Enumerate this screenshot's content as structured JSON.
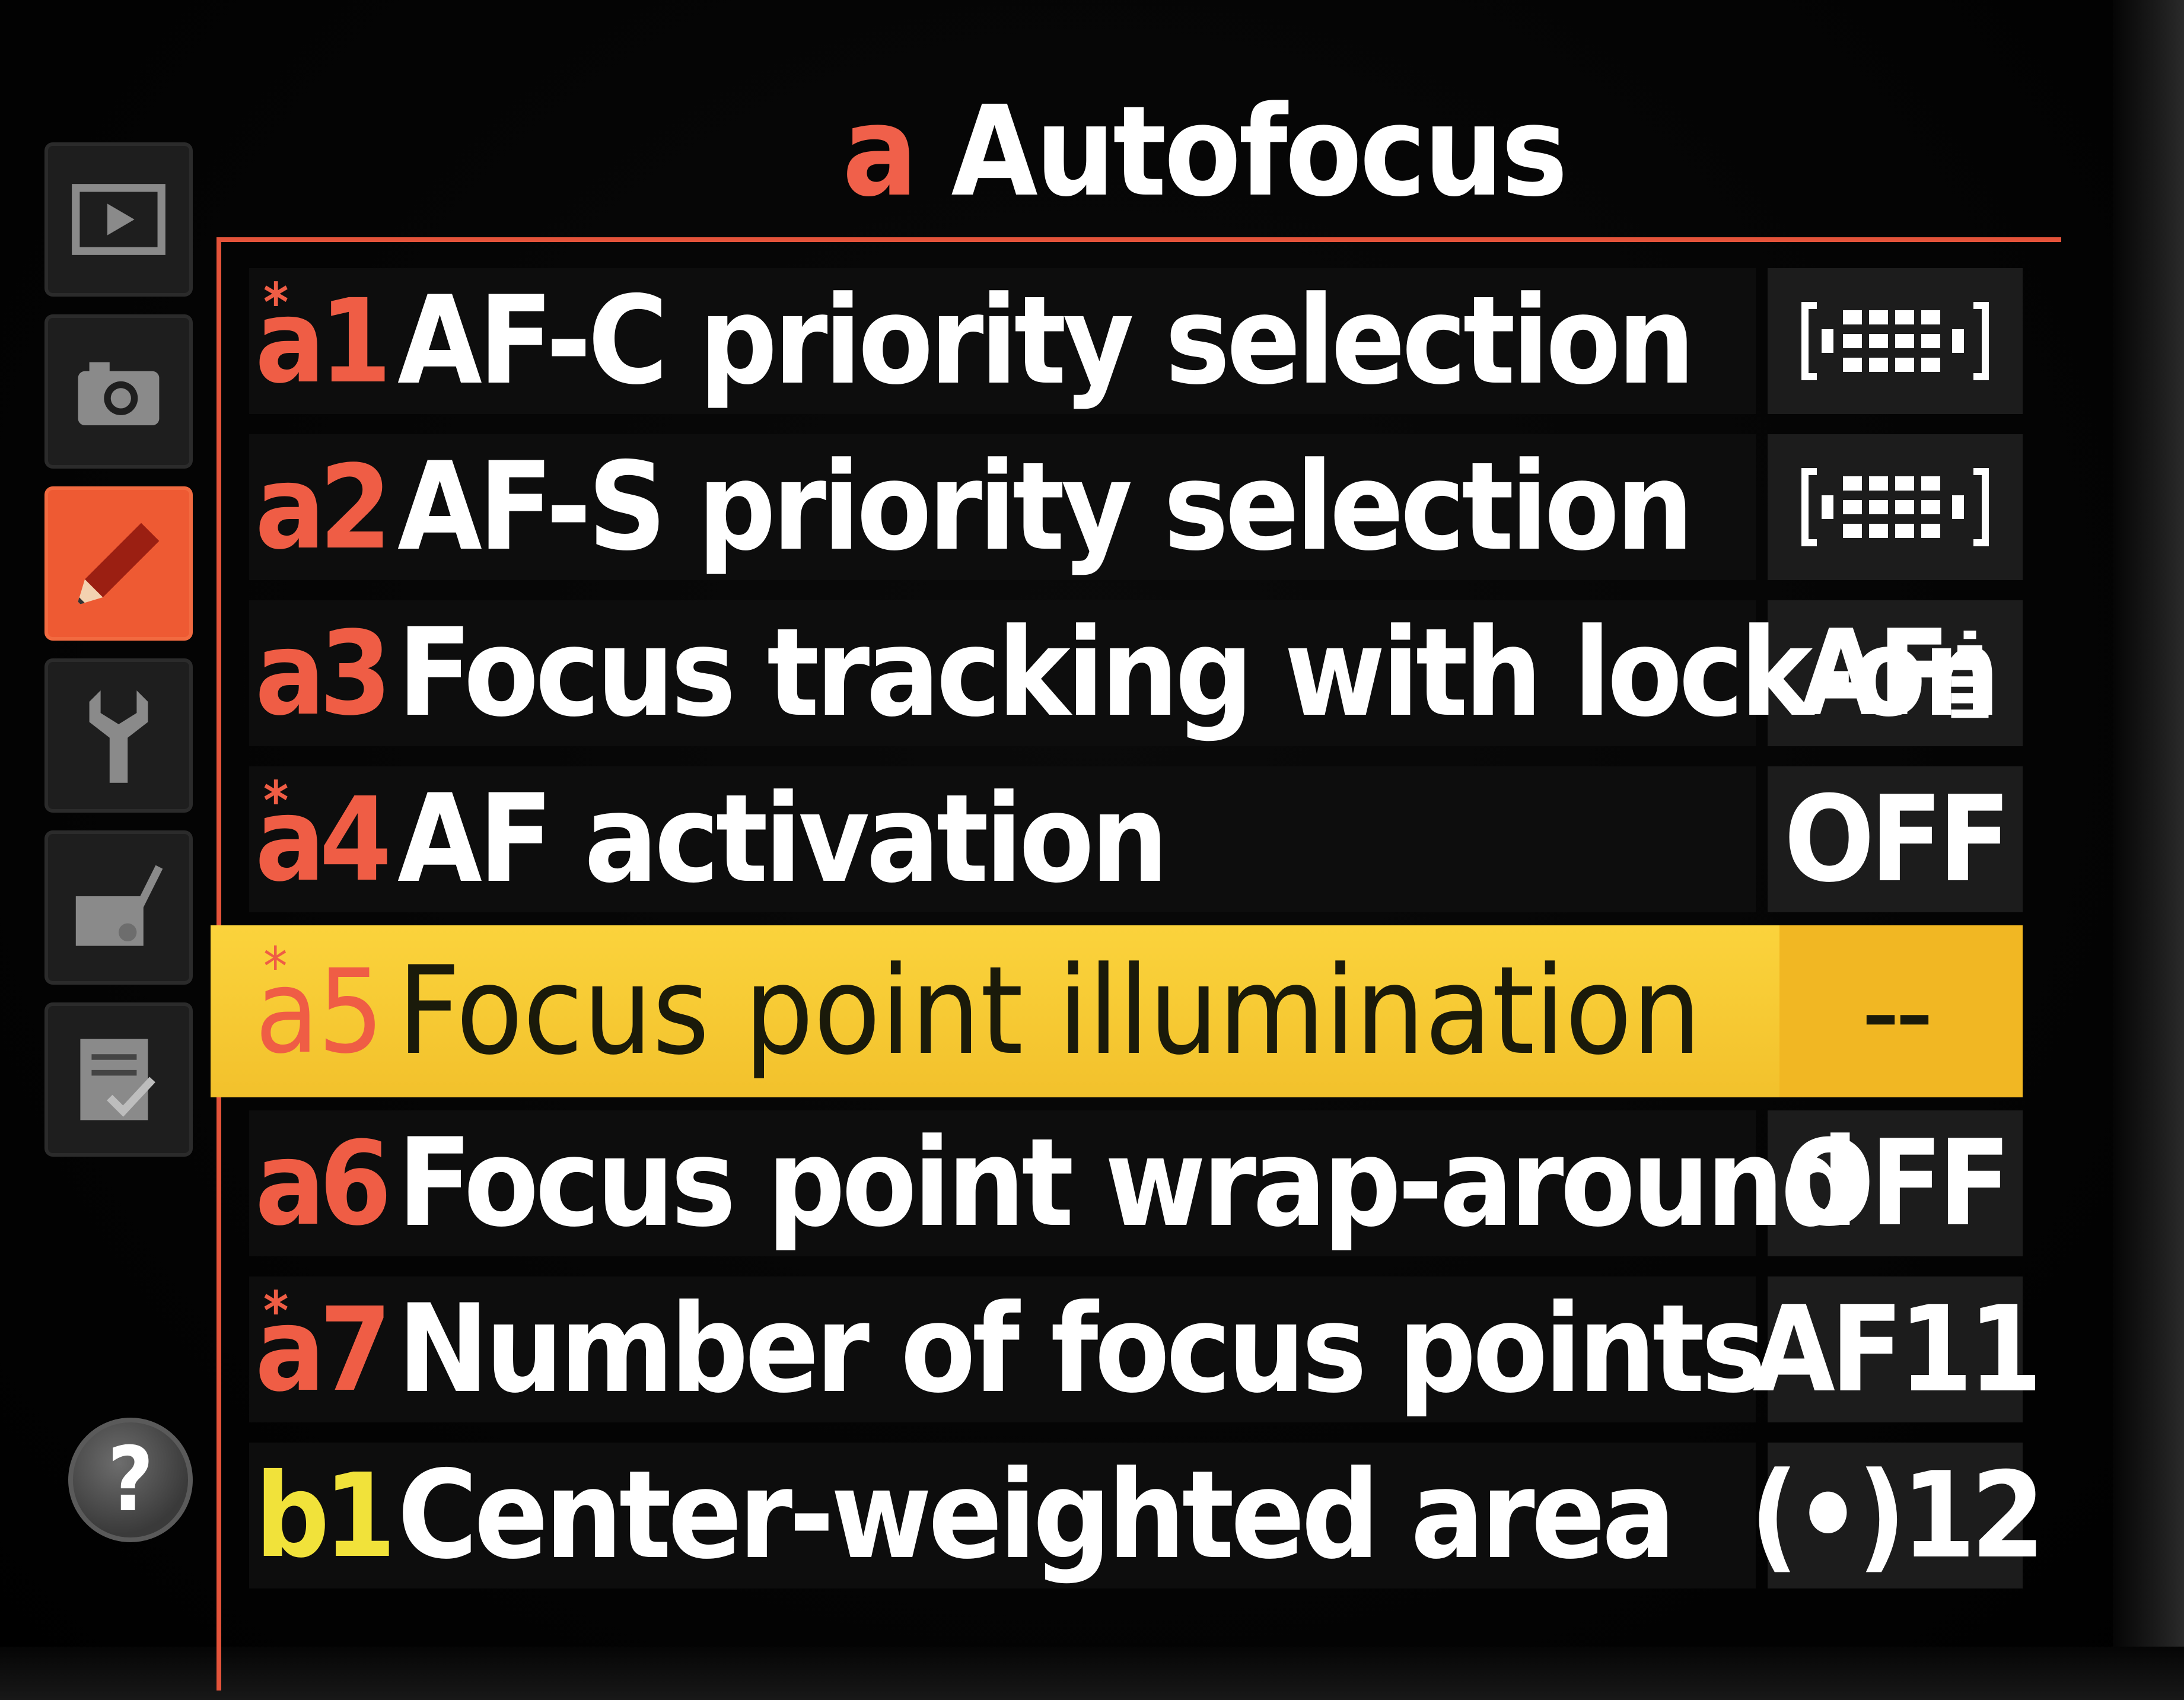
{
  "menu": {
    "letter": "a",
    "title": "Autofocus"
  },
  "sidebar": {
    "tabs": [
      {
        "name": "playback-tab",
        "icon": "playback-icon"
      },
      {
        "name": "shooting-tab",
        "icon": "camera-icon"
      },
      {
        "name": "custom-settings-tab",
        "icon": "pencil-icon",
        "active": true
      },
      {
        "name": "setup-tab",
        "icon": "wrench-icon"
      },
      {
        "name": "retouch-tab",
        "icon": "retouch-icon"
      },
      {
        "name": "my-menu-tab",
        "icon": "my-menu-icon"
      }
    ],
    "help_label": "?"
  },
  "items": [
    {
      "code": "a1",
      "star": "*",
      "label": "AF-C priority selection",
      "value_icon": "release-priority-icon"
    },
    {
      "code": "a2",
      "star": "",
      "label": "AF-S priority selection",
      "value_icon": "release-priority-icon"
    },
    {
      "code": "a3",
      "star": "",
      "label": "Focus tracking with lock-on",
      "value": "AF"
    },
    {
      "code": "a4",
      "star": "*",
      "label": "AF activation",
      "value": "OFF"
    },
    {
      "code": "a5",
      "star": "*",
      "label": "Focus point illumination",
      "value": "--",
      "selected": true
    },
    {
      "code": "a6",
      "star": "",
      "label": "Focus point wrap-around",
      "value": "OFF"
    },
    {
      "code": "a7",
      "star": "*",
      "label": "Number of focus points",
      "value": "AF11"
    },
    {
      "code": "b1",
      "star": "",
      "label": "Center-weighted area",
      "value": "(•)12"
    }
  ],
  "colors": {
    "accent": "#ee5a33",
    "highlight": "#f7c633",
    "next_group": "#f1e23a"
  }
}
